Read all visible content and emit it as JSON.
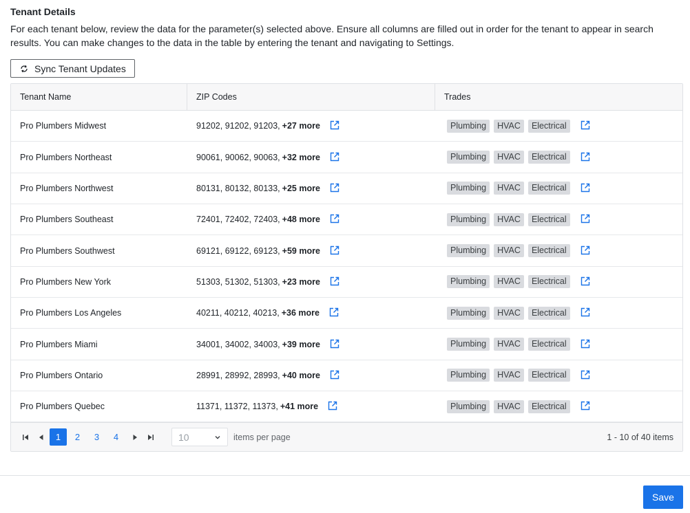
{
  "section": {
    "title": "Tenant Details",
    "description": "For each tenant below, review the data for the parameter(s) selected above. Ensure all columns are filled out in order for the tenant to appear in search results. You can make changes to the data in the table by entering the tenant and navigating to Settings."
  },
  "sync_button": {
    "label": "Sync Tenant Updates",
    "icon": "refresh-icon"
  },
  "table": {
    "columns": [
      "Tenant Name",
      "ZIP Codes",
      "Trades"
    ],
    "rows": [
      {
        "name": "Pro Plumbers Midwest",
        "zips": "91202, 91202, 91203,",
        "more": "+27 more",
        "trades": [
          "Plumbing",
          "HVAC",
          "Electrical"
        ]
      },
      {
        "name": "Pro Plumbers Northeast",
        "zips": "90061, 90062, 90063,",
        "more": "+32 more",
        "trades": [
          "Plumbing",
          "HVAC",
          "Electrical"
        ]
      },
      {
        "name": "Pro Plumbers Northwest",
        "zips": "80131, 80132, 80133,",
        "more": "+25 more",
        "trades": [
          "Plumbing",
          "HVAC",
          "Electrical"
        ]
      },
      {
        "name": "Pro Plumbers Southeast",
        "zips": "72401, 72402, 72403,",
        "more": "+48 more",
        "trades": [
          "Plumbing",
          "HVAC",
          "Electrical"
        ]
      },
      {
        "name": "Pro Plumbers Southwest",
        "zips": "69121, 69122, 69123,",
        "more": "+59 more",
        "trades": [
          "Plumbing",
          "HVAC",
          "Electrical"
        ]
      },
      {
        "name": "Pro Plumbers New York",
        "zips": "51303, 51302, 51303,",
        "more": "+23 more",
        "trades": [
          "Plumbing",
          "HVAC",
          "Electrical"
        ]
      },
      {
        "name": "Pro Plumbers Los Angeles",
        "zips": "40211, 40212, 40213,",
        "more": "+36 more",
        "trades": [
          "Plumbing",
          "HVAC",
          "Electrical"
        ]
      },
      {
        "name": "Pro Plumbers Miami",
        "zips": "34001, 34002, 34003,",
        "more": "+39 more",
        "trades": [
          "Plumbing",
          "HVAC",
          "Electrical"
        ]
      },
      {
        "name": "Pro Plumbers Ontario",
        "zips": "28991, 28992, 28993,",
        "more": "+40 more",
        "trades": [
          "Plumbing",
          "HVAC",
          "Electrical"
        ]
      },
      {
        "name": "Pro Plumbers Quebec",
        "zips": "11371, 11372, 11373,",
        "more": "+41 more",
        "trades": [
          "Plumbing",
          "HVAC",
          "Electrical"
        ]
      }
    ]
  },
  "pager": {
    "pages": [
      "1",
      "2",
      "3",
      "4"
    ],
    "current_page": "1",
    "items_per_page": "10",
    "items_per_page_label": "items per page",
    "info": "1 - 10 of 40 items"
  },
  "save_button": {
    "label": "Save"
  },
  "colors": {
    "accent": "#1a73e8",
    "chip_bg": "#d9dbdf",
    "header_bg": "#f7f7f8"
  }
}
